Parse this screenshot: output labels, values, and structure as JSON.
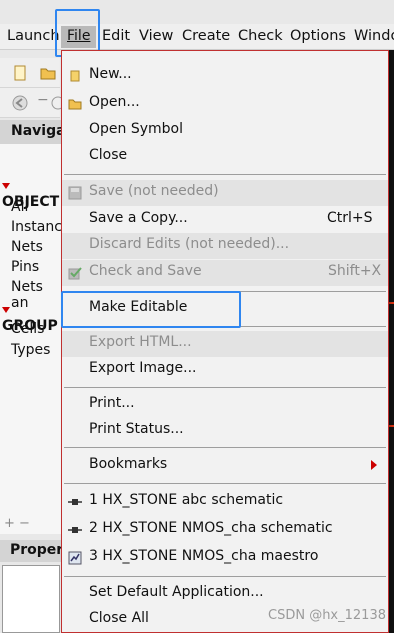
{
  "menubar": {
    "items": [
      "Launch",
      "File",
      "Edit",
      "View",
      "Create",
      "Check",
      "Options",
      "Windo"
    ]
  },
  "navigator": {
    "title": "Navigat",
    "objects_label": "OBJECT",
    "object_items": [
      "All",
      "Instance",
      "Nets",
      "Pins",
      "Nets an"
    ],
    "groups_label": "GROUP",
    "group_items": [
      "Cells",
      "Types"
    ],
    "add_remove": "+ −"
  },
  "properties": {
    "title": "Proper"
  },
  "file_menu": {
    "new": "New...",
    "open": "Open...",
    "open_symbol": "Open Symbol",
    "close": "Close",
    "save": "Save (not needed)",
    "save_copy": "Save a Copy...",
    "save_copy_shortcut": "Ctrl+S",
    "discard": "Discard Edits (not needed)...",
    "check_save": "Check and Save",
    "check_save_shortcut": "Shift+X",
    "make_editable": "Make Editable",
    "export_html": "Export HTML...",
    "export_image": "Export Image...",
    "print": "Print...",
    "print_status": "Print Status...",
    "bookmarks": "Bookmarks",
    "recent1": "1 HX_STONE  abc  schematic",
    "recent2": "2 HX_STONE  NMOS_cha  schematic",
    "recent3": "3 HX_STONE  NMOS_cha  maestro",
    "set_default": "Set Default Application...",
    "close_all": "Close All"
  },
  "watermark": "CSDN @hx_12138",
  "colors": {
    "highlight": "#2f86f0",
    "menu_border": "#c03030"
  }
}
